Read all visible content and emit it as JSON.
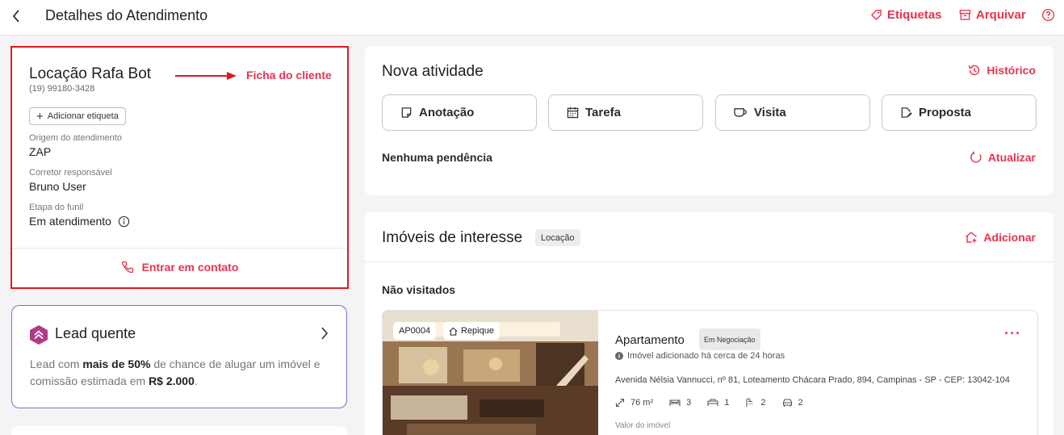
{
  "header": {
    "title": "Detalhes do Atendimento",
    "etiquetas_label": "Etiquetas",
    "arquivar_label": "Arquivar"
  },
  "client": {
    "name": "Locação Rafa Bot",
    "phone": "(19) 99180-3428",
    "ficha_label": "Ficha do cliente",
    "add_tag_label": "Adicionar etiqueta",
    "fields": [
      {
        "label": "Origem do atendimento",
        "value": "ZAP"
      },
      {
        "label": "Corretor responsável",
        "value": "Bruno User"
      },
      {
        "label": "Etapa do funil",
        "value": "Em atendimento"
      }
    ],
    "contact_label": "Entrar em contato"
  },
  "lead": {
    "title": "Lead quente",
    "text_1": "Lead com ",
    "text_bold_1": "mais de 50%",
    "text_2": " de chance de alugar um imóvel e comissão estimada em ",
    "text_bold_2": "R$ 2.000",
    "text_3": "."
  },
  "activity": {
    "title": "Nova atividade",
    "history_label": "Histórico",
    "buttons": [
      "Anotação",
      "Tarefa",
      "Visita",
      "Proposta"
    ],
    "pending_label": "Nenhuma pendência",
    "refresh_label": "Atualizar"
  },
  "imoveis": {
    "title": "Imóveis de interesse",
    "badge": "Locação",
    "add_label": "Adicionar",
    "section_label": "Não visitados",
    "property": {
      "code": "AP0004",
      "tag": "Repique",
      "type": "Apartamento",
      "status": "Em Negociação",
      "added": "Imóvel adicionado há cerca de 24 horas",
      "address": "Avenida Nélsia Vannucci, nº 81, Loteamento Chácara Prado, 894, Campinas - SP - CEP: 13042-104",
      "area": "76 m²",
      "bedrooms": "3",
      "suites": "1",
      "bathrooms": "2",
      "parking": "2",
      "valor_label": "Valor do imóvel"
    }
  },
  "colors": {
    "accent": "#e8334f",
    "highlight_border": "#e0181e",
    "lead_border": "#7b6fd0",
    "lead_badge": "#b03a8a"
  }
}
